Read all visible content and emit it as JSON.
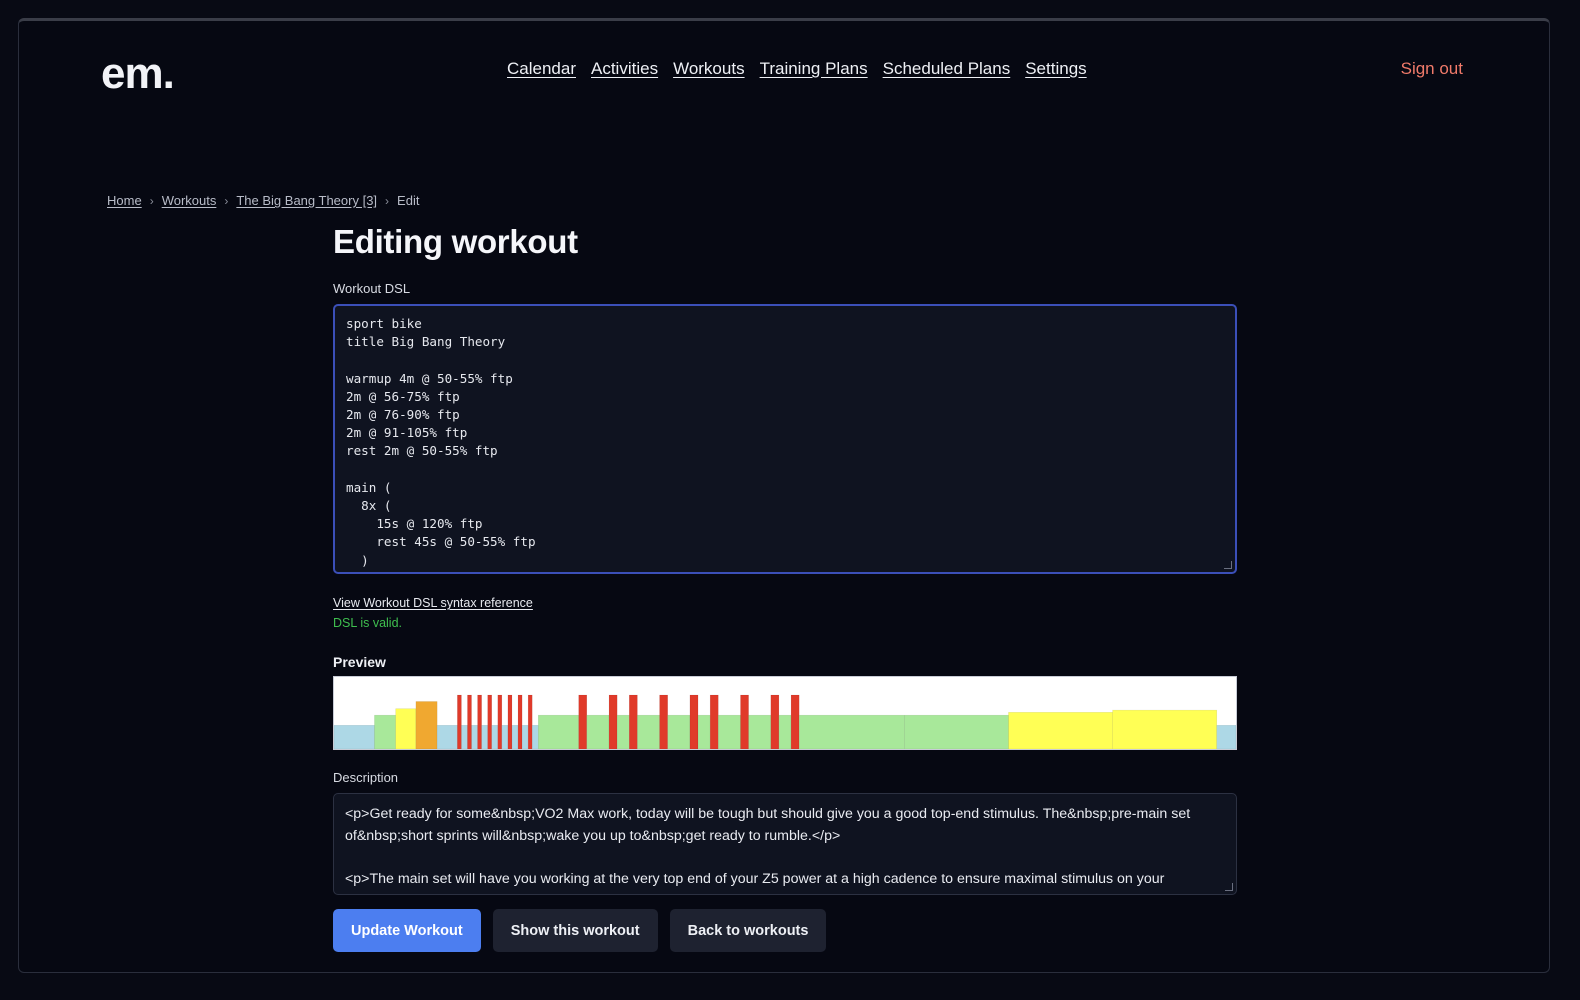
{
  "header": {
    "logo": "em.",
    "nav": [
      "Calendar",
      "Activities",
      "Workouts",
      "Training Plans",
      "Scheduled Plans",
      "Settings"
    ],
    "sign_out": "Sign out"
  },
  "breadcrumb": {
    "items": [
      "Home",
      "Workouts",
      "The Big Bang Theory [3]"
    ],
    "current": "Edit"
  },
  "page": {
    "title": "Editing workout",
    "dsl_label": "Workout DSL",
    "dsl_value": "sport bike\ntitle Big Bang Theory\n\nwarmup 4m @ 50-55% ftp\n2m @ 56-75% ftp\n2m @ 76-90% ftp\n2m @ 91-105% ftp\nrest 2m @ 50-55% ftp\n\nmain (\n  8x (\n    15s @ 120% ftp\n    rest 45s @ 50-55% ftp\n  )",
    "syntax_link": "View Workout DSL syntax reference",
    "validation_status": "DSL is valid.",
    "preview_label": "Preview",
    "description_label": "Description",
    "description_lines": [
      "<p>Get ready for some&nbsp;VO2 Max work, today will be tough but should give you a good top-end stimulus. The&nbsp;pre-main set of&nbsp;short sprints will&nbsp;wake you up to&nbsp;get ready to rumble.</p>",
      "<p>The main set will have you working at the very top end of your Z5 power at a high cadence to ensure maximal stimulus on your cardiovascular system (rather than your muscular system). The rest periods are short and the recovery work"
    ]
  },
  "buttons": {
    "update": "Update Workout",
    "show": "Show this workout",
    "back": "Back to workouts"
  },
  "colors": {
    "accent": "#4c7ef0",
    "sign_out": "#f07a6a",
    "valid": "#3fbf4f",
    "zone_recovery": "#add8e6",
    "zone_endurance": "#a8e89a",
    "zone_tempo": "#ffff55",
    "zone_threshold": "#f0a830",
    "zone_vo2": "#e03a2a"
  },
  "chart_data": {
    "type": "bar",
    "segments": [
      {
        "w": 40,
        "h": 0.33,
        "color": "zone_recovery"
      },
      {
        "w": 21,
        "h": 0.47,
        "color": "zone_endurance"
      },
      {
        "w": 20,
        "h": 0.56,
        "color": "zone_tempo"
      },
      {
        "w": 21,
        "h": 0.66,
        "color": "zone_threshold"
      },
      {
        "w": 20,
        "h": 0.33,
        "color": "zone_recovery"
      },
      {
        "w": 4,
        "h": 0.75,
        "color": "zone_vo2"
      },
      {
        "w": 6,
        "h": 0.33,
        "color": "zone_recovery"
      },
      {
        "w": 4,
        "h": 0.75,
        "color": "zone_vo2"
      },
      {
        "w": 6,
        "h": 0.33,
        "color": "zone_recovery"
      },
      {
        "w": 4,
        "h": 0.75,
        "color": "zone_vo2"
      },
      {
        "w": 6,
        "h": 0.33,
        "color": "zone_recovery"
      },
      {
        "w": 4,
        "h": 0.75,
        "color": "zone_vo2"
      },
      {
        "w": 6,
        "h": 0.33,
        "color": "zone_recovery"
      },
      {
        "w": 4,
        "h": 0.75,
        "color": "zone_vo2"
      },
      {
        "w": 6,
        "h": 0.33,
        "color": "zone_recovery"
      },
      {
        "w": 4,
        "h": 0.75,
        "color": "zone_vo2"
      },
      {
        "w": 6,
        "h": 0.33,
        "color": "zone_recovery"
      },
      {
        "w": 4,
        "h": 0.75,
        "color": "zone_vo2"
      },
      {
        "w": 6,
        "h": 0.33,
        "color": "zone_recovery"
      },
      {
        "w": 4,
        "h": 0.75,
        "color": "zone_vo2"
      },
      {
        "w": 6,
        "h": 0.33,
        "color": "zone_recovery"
      },
      {
        "w": 40,
        "h": 0.47,
        "color": "zone_endurance"
      },
      {
        "w": 8,
        "h": 0.75,
        "color": "zone_vo2"
      },
      {
        "w": 22,
        "h": 0.47,
        "color": "zone_endurance"
      },
      {
        "w": 8,
        "h": 0.75,
        "color": "zone_vo2"
      },
      {
        "w": 12,
        "h": 0.47,
        "color": "zone_endurance"
      },
      {
        "w": 8,
        "h": 0.75,
        "color": "zone_vo2"
      },
      {
        "w": 22,
        "h": 0.47,
        "color": "zone_endurance"
      },
      {
        "w": 8,
        "h": 0.75,
        "color": "zone_vo2"
      },
      {
        "w": 22,
        "h": 0.47,
        "color": "zone_endurance"
      },
      {
        "w": 8,
        "h": 0.75,
        "color": "zone_vo2"
      },
      {
        "w": 12,
        "h": 0.47,
        "color": "zone_endurance"
      },
      {
        "w": 8,
        "h": 0.75,
        "color": "zone_vo2"
      },
      {
        "w": 22,
        "h": 0.47,
        "color": "zone_endurance"
      },
      {
        "w": 8,
        "h": 0.75,
        "color": "zone_vo2"
      },
      {
        "w": 22,
        "h": 0.47,
        "color": "zone_endurance"
      },
      {
        "w": 8,
        "h": 0.75,
        "color": "zone_vo2"
      },
      {
        "w": 12,
        "h": 0.47,
        "color": "zone_endurance"
      },
      {
        "w": 8,
        "h": 0.75,
        "color": "zone_vo2"
      },
      {
        "w": 104,
        "h": 0.47,
        "color": "zone_endurance"
      },
      {
        "w": 103,
        "h": 0.47,
        "color": "zone_endurance"
      },
      {
        "w": 103,
        "h": 0.51,
        "color": "zone_tempo"
      },
      {
        "w": 103,
        "h": 0.54,
        "color": "zone_tempo"
      },
      {
        "w": 19,
        "h": 0.33,
        "color": "zone_recovery"
      }
    ]
  }
}
